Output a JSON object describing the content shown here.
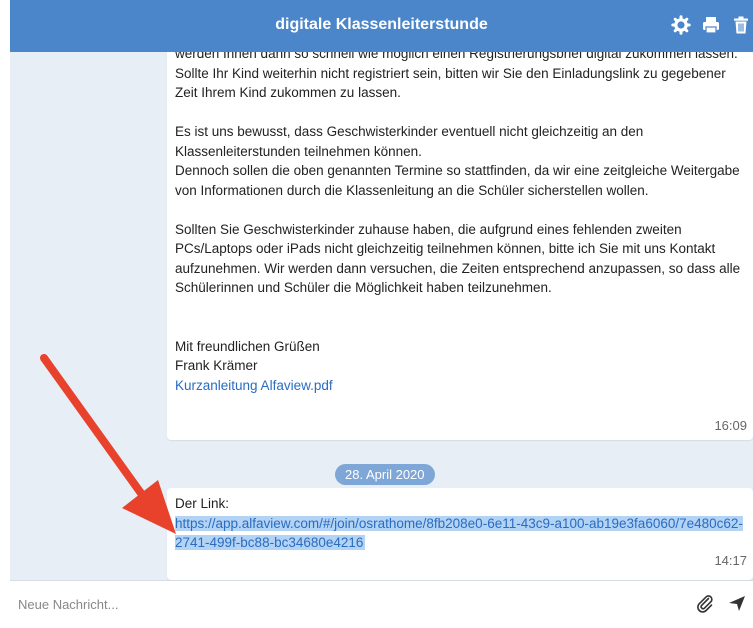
{
  "header": {
    "title": "digitale Klassenleiterstunde",
    "icons": [
      "gear-icon",
      "print-icon",
      "trash-icon"
    ],
    "color": "#4a86c9"
  },
  "messages": {
    "first": {
      "paragraphs": [
        "werden Ihnen dann so schnell wie möglich einen Registrierungsbrief digital zukommen lassen.\nSollte Ihr Kind weiterhin nicht registriert sein, bitten wir Sie den Einladungslink zu gegebener Zeit Ihrem Kind zukommen zu lassen.",
        "Es ist uns bewusst, dass Geschwisterkinder eventuell nicht gleichzeitig an den Klassenleiterstunden teilnehmen können.\nDennoch sollen die oben genannten Termine so stattfinden, da wir eine zeitgleiche Weitergabe von Informationen durch die Klassenleitung an die Schüler sicherstellen wollen.",
        "Sollten Sie Geschwisterkinder zuhause haben, die aufgrund eines fehlenden zweiten PCs/Laptops oder iPads nicht gleichzeitig teilnehmen können, bitte ich Sie mit uns Kontakt aufzunehmen. Wir werden dann versuchen, die Zeiten entsprechend anzupassen, so dass alle Schülerinnen und Schüler die Möglichkeit haben teilzunehmen."
      ],
      "greeting": "Mit freundlichen Grüßen",
      "signature": "Frank Krämer",
      "attachment": "Kurzanleitung Alfaview.pdf",
      "time": "16:09"
    },
    "date_separator": "28. April 2020",
    "second": {
      "intro": "Der Link:",
      "link": "https://app.alfaview.com/#/join/osrathome/8fb208e0-6e11-43c9-a100-ab19e3fa6060/7e480c62-2741-499f-bc88-bc34680e4216",
      "time": "14:17"
    }
  },
  "compose": {
    "placeholder": "Neue Nachricht...",
    "icons": [
      "paperclip-icon",
      "send-icon"
    ]
  },
  "colors": {
    "chat_background": "#e8eef6",
    "link": "#2a6cc0",
    "selection": "#b3d3f5",
    "annotation_arrow": "#e8412c"
  }
}
